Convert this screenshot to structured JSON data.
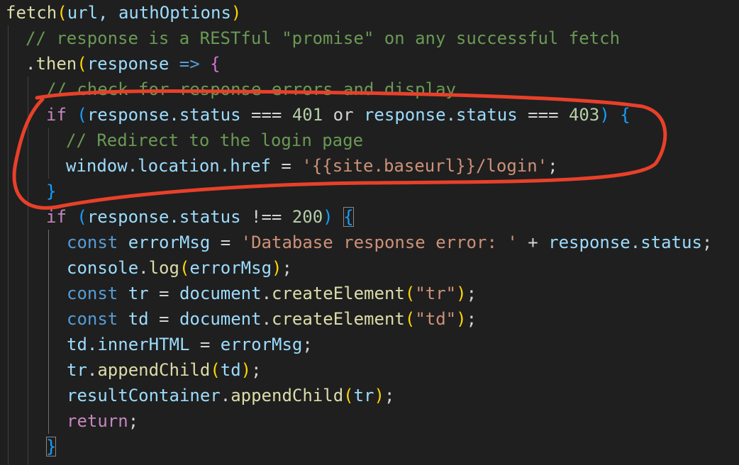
{
  "code": {
    "l1": {
      "fn": "fetch",
      "open": "(",
      "args": "url, authOptions",
      "close": ")"
    },
    "l2": {
      "comment": "// response is a RESTful \"promise\" on any successful fetch"
    },
    "l3": {
      "dot": ".",
      "method": "then",
      "open": "(",
      "param": "response",
      "arrow": " => ",
      "brace": "{"
    },
    "l4": {
      "comment": "// check for response errors and display"
    },
    "l5": {
      "kw": "if",
      "sp": " ",
      "open": "(",
      "a": "response.status",
      "op1": " === ",
      "n1": "401",
      "or": " or ",
      "b": "response.status",
      "op2": " === ",
      "n2": "403",
      "close": ")",
      "sp2": " ",
      "brace": "{"
    },
    "l6": {
      "comment": "// Redirect to the login page"
    },
    "l7": {
      "lhs": "window.location.href",
      "eq": " = ",
      "str": "'{{site.baseurl}}/login'",
      "semi": ";"
    },
    "l8": {
      "brace": "}"
    },
    "l9": {
      "kw": "if",
      "sp": " ",
      "open": "(",
      "a": "response.status",
      "op": " !== ",
      "n": "200",
      "close": ")",
      "sp2": " ",
      "brace": "{"
    },
    "l10": {
      "kw": "const",
      "sp": " ",
      "name": "errorMsg",
      "eq": " = ",
      "str": "'Database response error: '",
      "plus": " + ",
      "rhs": "response.status",
      "semi": ";"
    },
    "l11": {
      "obj": "console",
      "dot": ".",
      "fn": "log",
      "open": "(",
      "arg": "errorMsg",
      "close": ")",
      "semi": ";"
    },
    "l12": {
      "kw": "const",
      "sp": " ",
      "name": "tr",
      "eq": " = ",
      "obj": "document",
      "dot": ".",
      "fn": "createElement",
      "open": "(",
      "str": "\"tr\"",
      "close": ")",
      "semi": ";"
    },
    "l13": {
      "kw": "const",
      "sp": " ",
      "name": "td",
      "eq": " = ",
      "obj": "document",
      "dot": ".",
      "fn": "createElement",
      "open": "(",
      "str": "\"td\"",
      "close": ")",
      "semi": ";"
    },
    "l14": {
      "lhs": "td.innerHTML",
      "eq": " = ",
      "rhs": "errorMsg",
      "semi": ";"
    },
    "l15": {
      "obj": "tr",
      "dot": ".",
      "fn": "appendChild",
      "open": "(",
      "arg": "td",
      "close": ")",
      "semi": ";"
    },
    "l16": {
      "obj": "resultContainer",
      "dot": ".",
      "fn": "appendChild",
      "open": "(",
      "arg": "tr",
      "close": ")",
      "semi": ";"
    },
    "l17": {
      "kw": "return",
      "semi": ";"
    },
    "l18": {
      "brace": "}"
    }
  },
  "colors": {
    "background": "#1f1f1f",
    "annotation": "#e8402a"
  }
}
